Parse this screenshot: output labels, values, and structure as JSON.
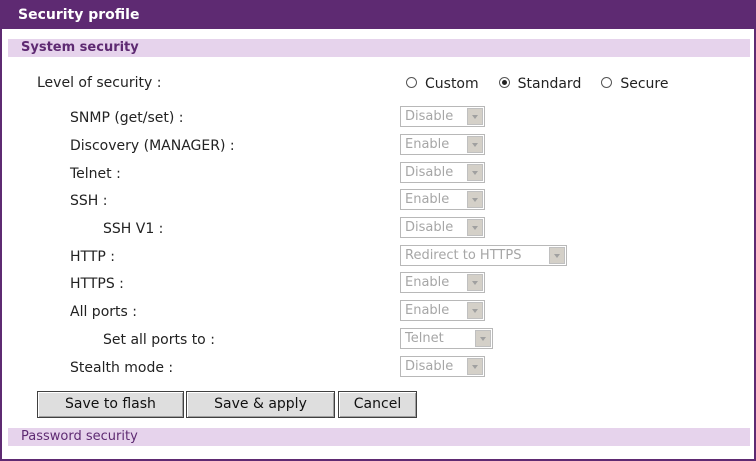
{
  "title": "Security profile",
  "system_security": {
    "heading": "System security",
    "level_label": "Level of security :",
    "level_options": [
      {
        "label": "Custom",
        "selected": false
      },
      {
        "label": "Standard",
        "selected": true
      },
      {
        "label": "Secure",
        "selected": false
      }
    ],
    "settings": [
      {
        "label": "SNMP (get/set) :",
        "value": "Disable"
      },
      {
        "label": "Discovery (MANAGER) :",
        "value": "Enable"
      },
      {
        "label": "Telnet :",
        "value": "Disable"
      },
      {
        "label": "SSH :",
        "value": "Enable"
      },
      {
        "label": "SSH V1 :",
        "value": "Disable"
      },
      {
        "label": "HTTP :",
        "value": "Redirect to HTTPS"
      },
      {
        "label": "HTTPS :",
        "value": "Enable"
      },
      {
        "label": "All ports :",
        "value": "Enable"
      },
      {
        "label": "Set all ports to :",
        "value": "Telnet"
      },
      {
        "label": "Stealth mode :",
        "value": "Disable"
      }
    ]
  },
  "buttons": {
    "save_flash": "Save to flash",
    "save_apply": "Save & apply",
    "cancel": "Cancel"
  },
  "password_security": {
    "heading": "Password security"
  }
}
